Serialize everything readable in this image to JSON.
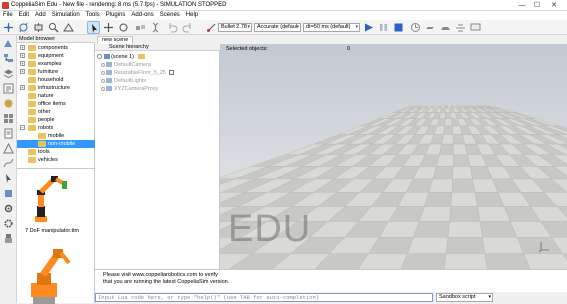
{
  "window": {
    "title": "CoppeliaSim Edu - New file - rendering: 8 ms (5.7 fps) - SIMULATION STOPPED",
    "minimize": "—",
    "maximize": "☐",
    "close": "✕"
  },
  "menu": [
    "File",
    "Edit",
    "Add",
    "Simulation",
    "Tools",
    "Plugins",
    "Add-ons",
    "Scenes",
    "Help"
  ],
  "toolbar": {
    "engine": "Bullet 2.78",
    "accuracy": "Accurate (defaul",
    "dt": "dt=50 ms (default)"
  },
  "model_browser": {
    "title": "Model browser",
    "items": [
      {
        "label": "components",
        "level": 0,
        "expander": "+"
      },
      {
        "label": "equipment",
        "level": 0,
        "expander": "+"
      },
      {
        "label": "examples",
        "level": 0,
        "expander": "+"
      },
      {
        "label": "furniture",
        "level": 0,
        "expander": "+"
      },
      {
        "label": "household",
        "level": 0,
        "expander": ""
      },
      {
        "label": "infrastructure",
        "level": 0,
        "expander": "+"
      },
      {
        "label": "nature",
        "level": 0,
        "expander": ""
      },
      {
        "label": "office items",
        "level": 0,
        "expander": ""
      },
      {
        "label": "other",
        "level": 0,
        "expander": ""
      },
      {
        "label": "people",
        "level": 0,
        "expander": ""
      },
      {
        "label": "robots",
        "level": 0,
        "expander": "−"
      },
      {
        "label": "mobile",
        "level": 1,
        "expander": ""
      },
      {
        "label": "non-mobile",
        "level": 1,
        "expander": "",
        "selected": true
      },
      {
        "label": "tools",
        "level": 0,
        "expander": ""
      },
      {
        "label": "vehicles",
        "level": 0,
        "expander": ""
      }
    ],
    "thumb_caption": "7 DoF manipulator.ttm"
  },
  "tabs": [
    "new scene"
  ],
  "scene_hierarchy": {
    "title": "Scene hierarchy",
    "root": "(scene 1)",
    "items": [
      "DefaultCamera",
      "ResizableFloor_5_25",
      "DefaultLights",
      "XYZCameraProxy"
    ]
  },
  "viewport": {
    "selected_label": "Selected objects:",
    "selected_count": "0",
    "watermark": "EDU"
  },
  "console": {
    "line1": "Please visit www.coppeliarobotics.com to verify",
    "line2": "that you are running the latest CoppeliaSim version."
  },
  "command": {
    "placeholder": "Input Lua code here, or type \"help()\" (use TAB for auto-completion)",
    "script": "Sandbox script"
  },
  "colors": {
    "accent": "#3399ff",
    "folder": "#e9c45c",
    "floor_light": "#d9d9d6",
    "floor_dark": "#c8c8c4",
    "sky_top": "#c3c9d2",
    "sky_bottom": "#eceeef"
  }
}
